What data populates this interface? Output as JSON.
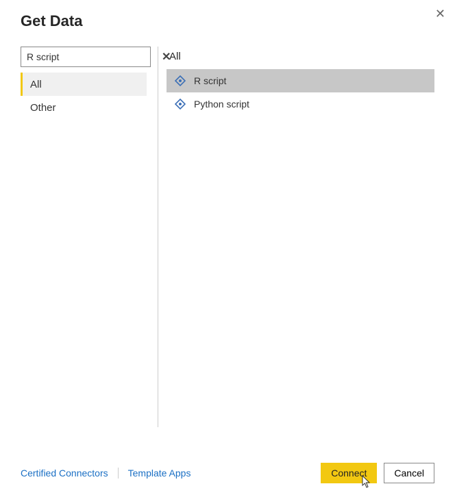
{
  "header": {
    "title": "Get Data"
  },
  "search": {
    "value": "R script",
    "placeholder": "Search"
  },
  "categories": [
    {
      "label": "All",
      "selected": true
    },
    {
      "label": "Other",
      "selected": false
    }
  ],
  "right": {
    "title": "All",
    "connectors": [
      {
        "label": "R script",
        "selected": true
      },
      {
        "label": "Python script",
        "selected": false
      }
    ]
  },
  "footer": {
    "links": [
      "Certified Connectors",
      "Template Apps"
    ],
    "connect": "Connect",
    "cancel": "Cancel"
  },
  "colors": {
    "accent": "#f2c811",
    "link": "#1a6fc4",
    "selection": "#c7c7c7"
  }
}
